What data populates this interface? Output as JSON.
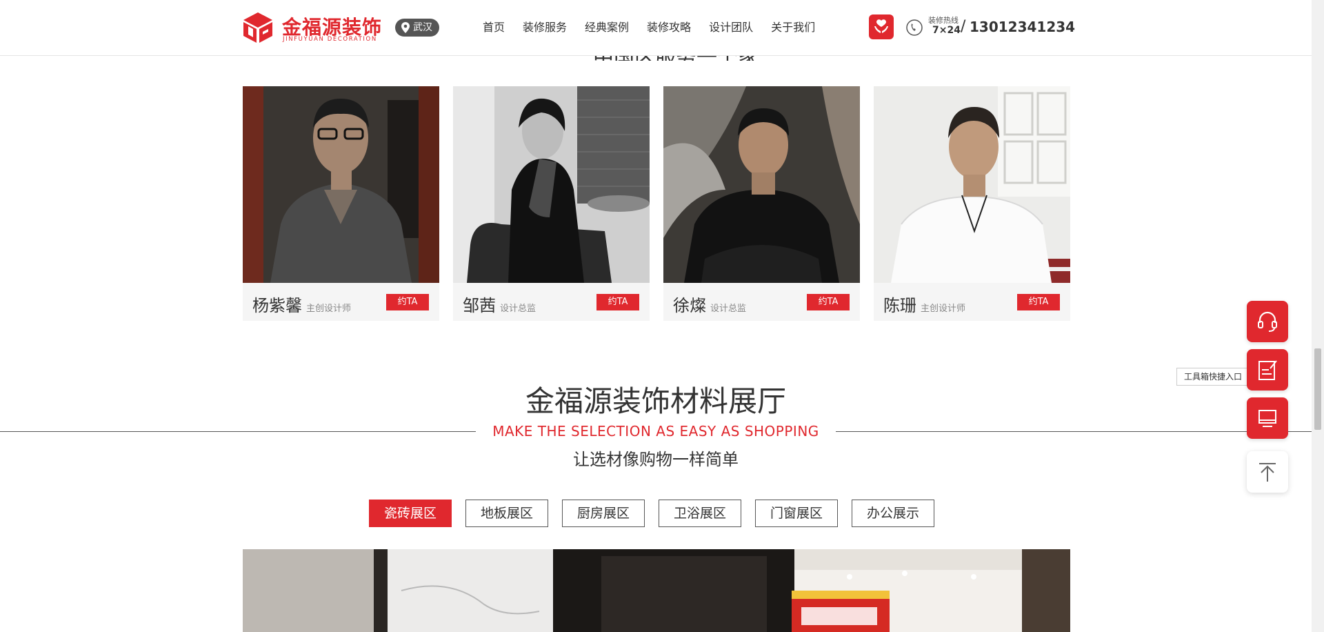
{
  "brand": {
    "name_cn": "金福源装饰",
    "name_en": "JINFUYUAN DECORATION",
    "accent": "#e0282e"
  },
  "city": "武汉",
  "nav": [
    "首页",
    "装修服务",
    "经典案例",
    "装修攻略",
    "设计团队",
    "关于我们"
  ],
  "hotline": {
    "label": "装修热线",
    "hours": "7×24",
    "separator": "/",
    "number": "13012341234"
  },
  "team_title_partial": "中国区服务一个家",
  "designers": [
    {
      "name": "杨紫馨",
      "role": "主创设计师",
      "button": "约TA"
    },
    {
      "name": "邹茜",
      "role": "设计总监",
      "button": "约TA"
    },
    {
      "name": "徐燦",
      "role": "设计总监",
      "button": "约TA"
    },
    {
      "name": "陈珊",
      "role": "主创设计师",
      "button": "约TA"
    }
  ],
  "hall": {
    "title": "金福源装饰材料展厅",
    "subtitle_en": "MAKE THE SELECTION AS EASY AS SHOPPING",
    "subtitle_cn": "让选材像购物一样简单",
    "tabs": [
      "瓷砖展区",
      "地板展区",
      "厨房展区",
      "卫浴展区",
      "门窗展区",
      "办公展示"
    ],
    "active_tab": 0
  },
  "sidebar": {
    "tooltip": "工具箱快捷入口",
    "tooltip_close": "✕",
    "items": [
      "headset-icon",
      "edit-note-icon",
      "monitor-icon",
      "back-to-top-icon"
    ]
  }
}
